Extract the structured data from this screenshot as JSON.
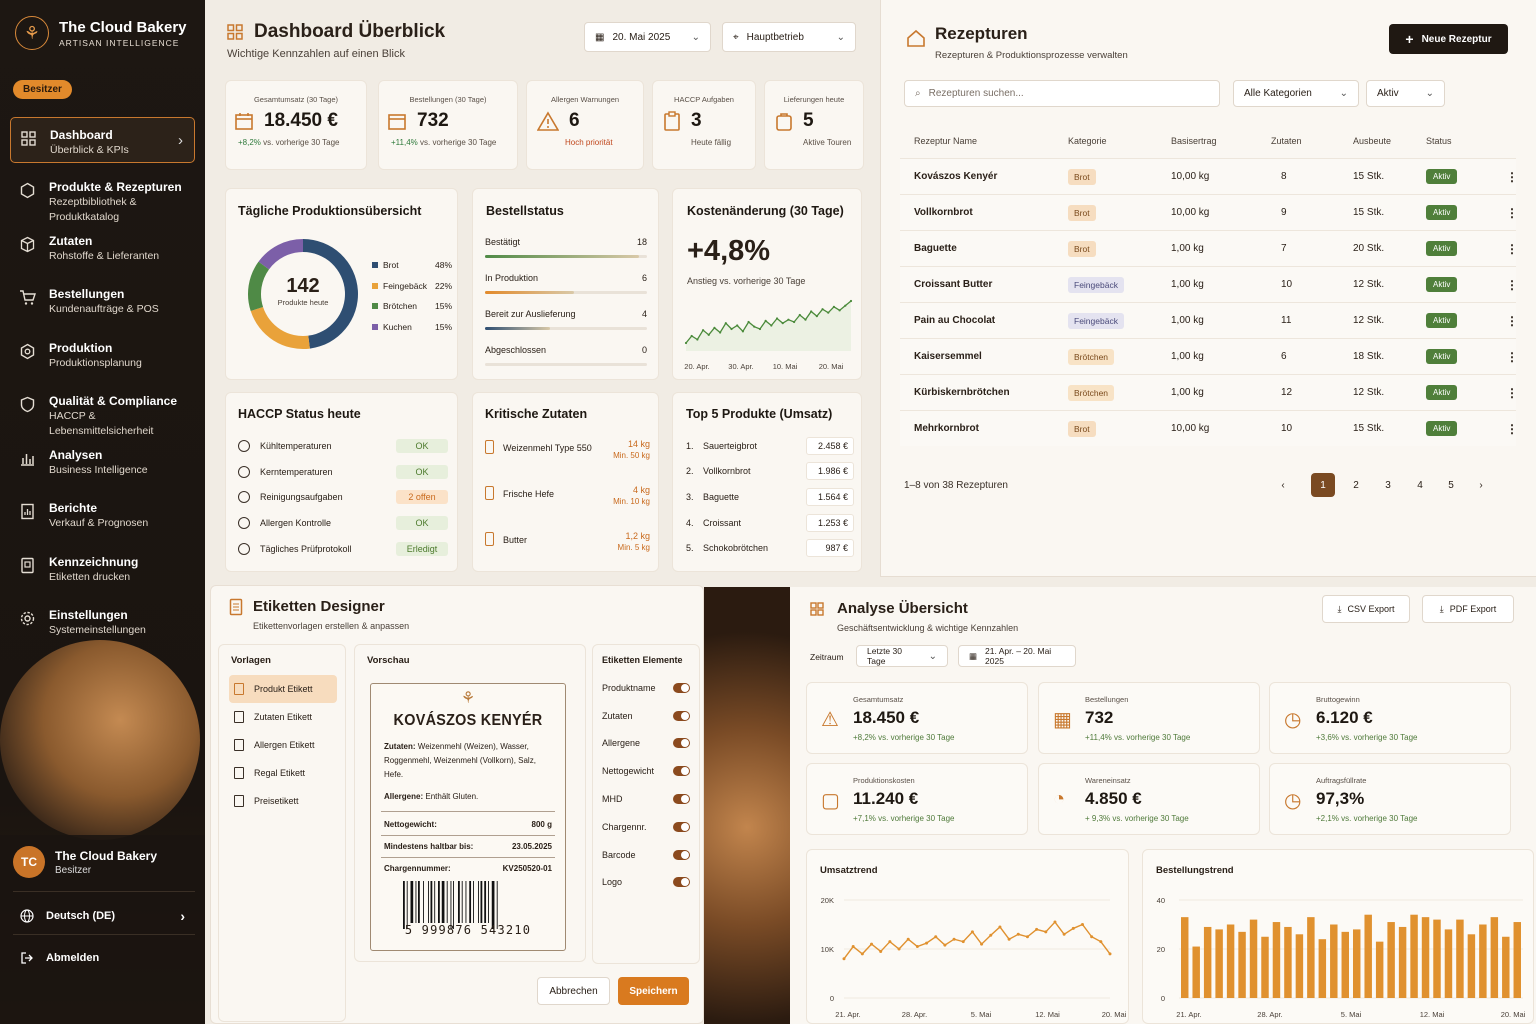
{
  "sidebar": {
    "brand_title": "The Cloud Bakery",
    "brand_subtitle": "ARTISAN INTELLIGENCE",
    "role_badge": "Besitzer",
    "items": [
      {
        "title": "Dashboard",
        "subtitle": "Überblick & KPIs",
        "icon": "grid-icon"
      },
      {
        "title": "Produkte & Rezepturen",
        "subtitle": "Rezeptbibliothek & Produktkatalog",
        "icon": "hexagon-icon"
      },
      {
        "title": "Zutaten",
        "subtitle": "Rohstoffe & Lieferanten",
        "icon": "box-icon"
      },
      {
        "title": "Bestellungen",
        "subtitle": "Kundenaufträge & POS",
        "icon": "cart-icon"
      },
      {
        "title": "Produktion",
        "subtitle": "Produktionsplanung",
        "icon": "gear-hex-icon"
      },
      {
        "title": "Qualität & Compliance",
        "subtitle": "HACCP & Lebensmittelsicherheit",
        "icon": "shield-icon"
      },
      {
        "title": "Analysen",
        "subtitle": "Business Intelligence",
        "icon": "bar-chart-icon"
      },
      {
        "title": "Berichte",
        "subtitle": "Verkauf & Prognosen",
        "icon": "report-icon"
      },
      {
        "title": "Kennzeichnung",
        "subtitle": "Etiketten drucken",
        "icon": "label-icon"
      },
      {
        "title": "Einstellungen",
        "subtitle": "Systemeinstellungen",
        "icon": "gear-icon"
      }
    ],
    "user": {
      "initials": "TC",
      "name": "The Cloud Bakery",
      "role": "Besitzer"
    },
    "language": "Deutsch (DE)",
    "logout": "Abmelden"
  },
  "dashboard": {
    "title": "Dashboard Überblick",
    "subtitle": "Wichtige Kennzahlen auf einen Blick",
    "date": "20. Mai 2025",
    "location": "Hauptbetrieb",
    "kpis": [
      {
        "label": "Gesamtumsatz (30 Tage)",
        "value": "18.450 €",
        "delta": "+8,2%",
        "delta_text": "vs. vorherige 30 Tage"
      },
      {
        "label": "Bestellungen (30 Tage)",
        "value": "732",
        "delta": "+11,4%",
        "delta_text": "vs. vorherige 30 Tage"
      },
      {
        "label": "Allergen Warnungen",
        "value": "6",
        "note": "Hoch priorität"
      },
      {
        "label": "HACCP Aufgaben",
        "value": "3",
        "note": "Heute fällig"
      },
      {
        "label": "Lieferungen heute",
        "value": "5",
        "note": "Aktive Touren"
      }
    ],
    "production": {
      "title": "Tägliche Produktionsübersicht",
      "total": "142",
      "total_label": "Produkte heute",
      "legend": [
        {
          "name": "Brot",
          "pct": "48%",
          "value": 48,
          "color": "#2e4e72"
        },
        {
          "name": "Feingebäck",
          "pct": "22%",
          "value": 22,
          "color": "#e9a23a"
        },
        {
          "name": "Brötchen",
          "pct": "15%",
          "value": 15,
          "color": "#4f8a46"
        },
        {
          "name": "Kuchen",
          "pct": "15%",
          "value": 15,
          "color": "#7c5fa8"
        }
      ]
    },
    "order_status": {
      "title": "Bestellstatus",
      "rows": [
        {
          "label": "Bestätigt",
          "count": "18",
          "fill": 0.95
        },
        {
          "label": "In Produktion",
          "count": "6",
          "fill": 0.55
        },
        {
          "label": "Bereit zur Auslieferung",
          "count": "4",
          "fill": 0.4
        },
        {
          "label": "Abgeschlossen",
          "count": "0",
          "fill": 0
        }
      ]
    },
    "cost": {
      "title": "Kostenänderung (30 Tage)",
      "value": "+4,8%",
      "subtitle": "Anstieg vs. vorherige 30 Tage",
      "x_ticks": [
        "20. Apr.",
        "30. Apr.",
        "10. Mai",
        "20. Mai"
      ]
    },
    "haccp": {
      "title": "HACCP Status heute",
      "rows": [
        {
          "label": "Kühltemperaturen",
          "status": "OK",
          "kind": "ok"
        },
        {
          "label": "Kerntemperaturen",
          "status": "OK",
          "kind": "ok"
        },
        {
          "label": "Reinigungsaufgaben",
          "status": "2 offen",
          "kind": "warn"
        },
        {
          "label": "Allergen Kontrolle",
          "status": "OK",
          "kind": "ok"
        },
        {
          "label": "Tägliches Prüfprotokoll",
          "status": "Erledigt",
          "kind": "ok"
        }
      ]
    },
    "critical": {
      "title": "Kritische Zutaten",
      "rows": [
        {
          "name": "Weizenmehl Type 550",
          "qty": "14 kg",
          "min": "Min. 50 kg"
        },
        {
          "name": "Frische Hefe",
          "qty": "4 kg",
          "min": "Min. 10 kg"
        },
        {
          "name": "Butter",
          "qty": "1,2 kg",
          "min": "Min. 5 kg"
        }
      ]
    },
    "top5": {
      "title": "Top 5 Produkte (Umsatz)",
      "rows": [
        {
          "rank": "1.",
          "name": "Sauerteigbrot",
          "value": "2.458 €"
        },
        {
          "rank": "2.",
          "name": "Vollkornbrot",
          "value": "1.986 €"
        },
        {
          "rank": "3.",
          "name": "Baguette",
          "value": "1.564 €"
        },
        {
          "rank": "4.",
          "name": "Croissant",
          "value": "1.253 €"
        },
        {
          "rank": "5.",
          "name": "Schokobrötchen",
          "value": "987 €"
        }
      ]
    }
  },
  "recipes": {
    "title": "Rezepturen",
    "subtitle": "Rezepturen & Produktionsprozesse verwalten",
    "new_button": "Neue Rezeptur",
    "search_placeholder": "Rezepturen suchen...",
    "category_filter": "Alle Kategorien",
    "status_filter": "Aktiv",
    "columns": [
      "Rezeptur Name",
      "Kategorie",
      "Basisertrag",
      "Zutaten",
      "Ausbeute",
      "Status"
    ],
    "rows": [
      {
        "name": "Kovászos Kenyér",
        "category": "Brot",
        "cat": "brot",
        "base": "10,00 kg",
        "ingredients": "8",
        "yield": "15 Stk.",
        "status": "Aktiv"
      },
      {
        "name": "Vollkornbrot",
        "category": "Brot",
        "cat": "brot",
        "base": "10,00 kg",
        "ingredients": "9",
        "yield": "15 Stk.",
        "status": "Aktiv"
      },
      {
        "name": "Baguette",
        "category": "Brot",
        "cat": "brot",
        "base": "1,00 kg",
        "ingredients": "7",
        "yield": "20 Stk.",
        "status": "Aktiv"
      },
      {
        "name": "Croissant Butter",
        "category": "Feingebäck",
        "cat": "fein",
        "base": "1,00 kg",
        "ingredients": "10",
        "yield": "12 Stk.",
        "status": "Aktiv"
      },
      {
        "name": "Pain au Chocolat",
        "category": "Feingebäck",
        "cat": "fein",
        "base": "1,00 kg",
        "ingredients": "11",
        "yield": "12 Stk.",
        "status": "Aktiv"
      },
      {
        "name": "Kaisersemmel",
        "category": "Brötchen",
        "cat": "brotch",
        "base": "1,00 kg",
        "ingredients": "6",
        "yield": "18 Stk.",
        "status": "Aktiv"
      },
      {
        "name": "Kürbiskernbrötchen",
        "category": "Brötchen",
        "cat": "brotch",
        "base": "1,00 kg",
        "ingredients": "12",
        "yield": "12 Stk.",
        "status": "Aktiv"
      },
      {
        "name": "Mehrkornbrot",
        "category": "Brot",
        "cat": "brot",
        "base": "10,00 kg",
        "ingredients": "10",
        "yield": "15 Stk.",
        "status": "Aktiv"
      }
    ],
    "pagination_text": "1–8 von 38 Rezepturen",
    "pages": [
      "1",
      "2",
      "3",
      "4",
      "5"
    ]
  },
  "labels": {
    "title": "Etiketten Designer",
    "subtitle": "Etikettenvorlagen erstellen & anpassen",
    "templates_title": "Vorlagen",
    "templates": [
      "Produkt Etikett",
      "Zutaten Etikett",
      "Allergen Etikett",
      "Regal Etikett",
      "Preisetikett"
    ],
    "preview_title": "Vorschau",
    "elements_title": "Etiketten Elemente",
    "elements": [
      "Produktname",
      "Zutaten",
      "Allergene",
      "Nettogewicht",
      "MHD",
      "Chargennr.",
      "Barcode",
      "Logo"
    ],
    "preview": {
      "product": "KOVÁSZOS KENYÉR",
      "ingredients_label": "Zutaten:",
      "ingredients": "Weizenmehl (Weizen), Wasser, Roggenmehl, Weizenmehl (Vollkorn), Salz, Hefe.",
      "allergens_label": "Allergene:",
      "allergens": "Enthält Gluten.",
      "weight_label": "Nettogewicht:",
      "weight": "800 g",
      "mhd_label": "Mindestens haltbar bis:",
      "mhd": "23.05.2025",
      "batch_label": "Chargennummer:",
      "batch": "KV250520-01",
      "barcode": "5 999876 543210"
    },
    "cancel": "Abbrechen",
    "save": "Speichern"
  },
  "analysis": {
    "title": "Analyse Übersicht",
    "subtitle": "Geschäftsentwicklung & wichtige Kennzahlen",
    "csv": "CSV Export",
    "pdf": "PDF Export",
    "period_label": "Zeitraum",
    "period": "Letzte 30 Tage",
    "range": "21. Apr. – 20. Mai 2025",
    "kpis": [
      {
        "label": "Gesamtumsatz",
        "value": "18.450 €",
        "delta": "+8,2% vs. vorherige 30 Tage"
      },
      {
        "label": "Bestellungen",
        "value": "732",
        "delta": "+11,4% vs. vorherige 30 Tage"
      },
      {
        "label": "Bruttogewinn",
        "value": "6.120 €",
        "delta": "+3,6% vs. vorherige 30 Tage"
      },
      {
        "label": "Produktionskosten",
        "value": "11.240 €",
        "delta": "+7,1% vs. vorherige 30 Tage"
      },
      {
        "label": "Wareneinsatz",
        "value": "4.850 €",
        "delta": "+ 9,3% vs. vorherige 30 Tage"
      },
      {
        "label": "Auftragsfüllrate",
        "value": "97,3%",
        "delta": "+2,1% vs. vorherige 30 Tage"
      }
    ]
  },
  "chart_data": [
    {
      "type": "line",
      "title": "Umsatztrend",
      "y_ticks": [
        "20K",
        "10K",
        "0"
      ],
      "ylim": [
        0,
        20000
      ],
      "x_ticks": [
        "21. Apr.",
        "28. Apr.",
        "5. Mai",
        "12. Mai",
        "20. Mai"
      ],
      "values": [
        8000,
        10500,
        9000,
        11000,
        9500,
        11500,
        10000,
        12000,
        10500,
        11200,
        12500,
        10800,
        12000,
        11500,
        13500,
        11000,
        12800,
        14500,
        12000,
        13000,
        12500,
        14000,
        13500,
        15500,
        13000,
        14200,
        15000,
        12500,
        11500,
        9000
      ]
    },
    {
      "type": "bar",
      "title": "Bestellungstrend",
      "y_ticks": [
        "40",
        "20",
        "0"
      ],
      "ylim": [
        0,
        40
      ],
      "x_ticks": [
        "21. Apr.",
        "28. Apr.",
        "5. Mai",
        "12. Mai",
        "20. Mai"
      ],
      "values": [
        33,
        21,
        29,
        28,
        30,
        27,
        32,
        25,
        31,
        29,
        26,
        33,
        24,
        30,
        27,
        28,
        34,
        23,
        31,
        29,
        34,
        33,
        32,
        28,
        32,
        26,
        30,
        33,
        25,
        31
      ]
    },
    {
      "type": "line",
      "title": "Kostenänderung (30 Tage)",
      "x_ticks": [
        "20. Apr.",
        "30. Apr.",
        "10. Mai",
        "20. Mai"
      ],
      "values": [
        1.2,
        1.8,
        1.5,
        2.3,
        1.9,
        2.5,
        2.1,
        2.9,
        2.4,
        2.7,
        2.2,
        3.0,
        2.6,
        2.4,
        3.1,
        2.7,
        3.3,
        2.9,
        3.2,
        3.0,
        3.6,
        3.2,
        3.9,
        3.5,
        4.1,
        3.8,
        4.3,
        4.0,
        4.4,
        4.8
      ]
    }
  ]
}
